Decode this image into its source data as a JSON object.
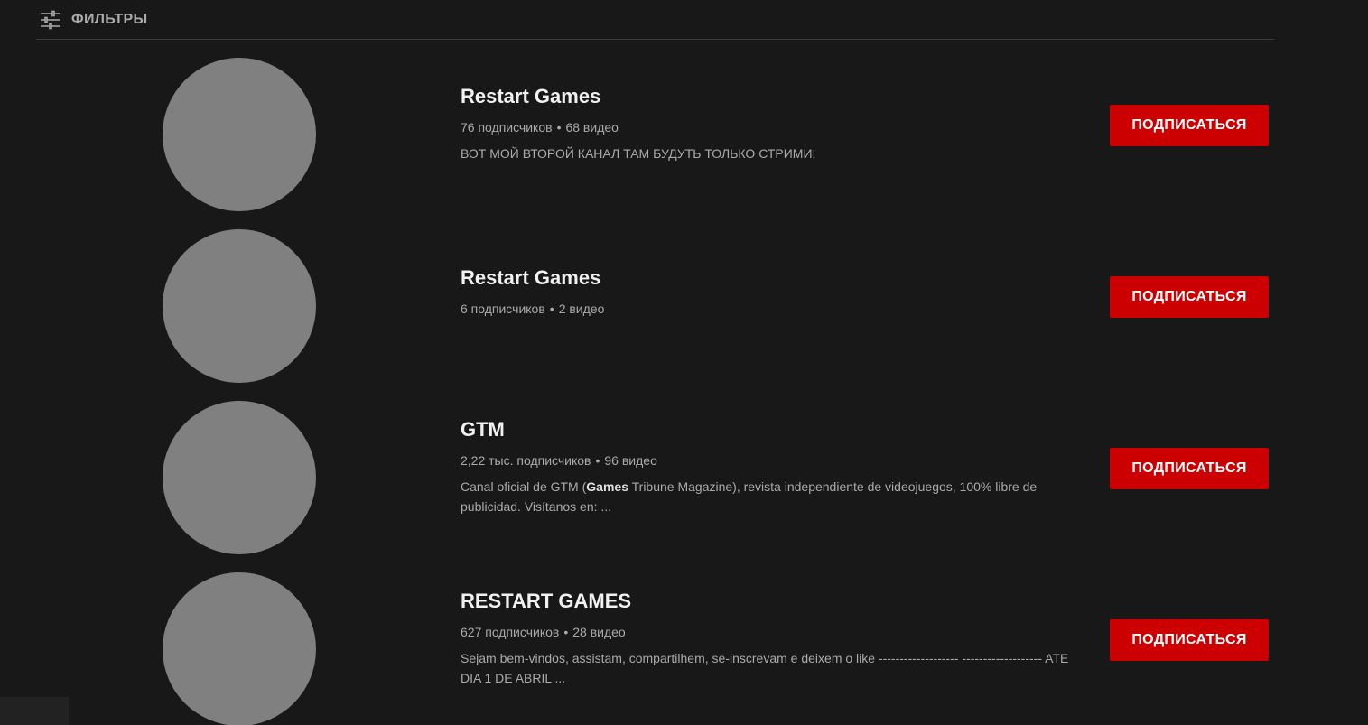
{
  "filters": {
    "label": "ФИЛЬТРЫ",
    "icon": "filter-sliders-icon"
  },
  "channels": [
    {
      "name": "Restart Games",
      "subscribers": "76 подписчиков",
      "separator": "•",
      "videos": "68 видео",
      "description": "ВОТ МОЙ ВТОРОЙ КАНАЛ ТАМ БУДУТЬ ТОЛЬКО СТРИМИ!",
      "subscribe_label": "ПОДПИСАТЬСЯ"
    },
    {
      "name": "Restart Games",
      "subscribers": "6 подписчиков",
      "separator": "•",
      "videos": "2 видео",
      "description": "",
      "subscribe_label": "ПОДПИСАТЬСЯ"
    },
    {
      "name": "GTM",
      "subscribers": "2,22 тыс. подписчиков",
      "separator": "•",
      "videos": "96 видео",
      "description_prefix": "Canal oficial de GTM (",
      "description_bold": "Games",
      "description_suffix": " Tribune Magazine), revista independiente de videojuegos, 100% libre de publicidad. Visítanos en: ...",
      "subscribe_label": "ПОДПИСАТЬСЯ"
    },
    {
      "name": "RESTART GAMES",
      "subscribers": "627 подписчиков",
      "separator": "•",
      "videos": "28 видео",
      "description": "Sejam bem-vindos, assistam, compartilhem, se-inscrevam e deixem o like ------------------- ------------------- ATE DIA 1 DE ABRIL ...",
      "subscribe_label": "ПОДПИСАТЬСЯ"
    }
  ],
  "colors": {
    "background": "#181818",
    "subscribe_button": "#cc0000",
    "avatar_placeholder": "#808080",
    "secondary_text": "#aaaaaa"
  }
}
